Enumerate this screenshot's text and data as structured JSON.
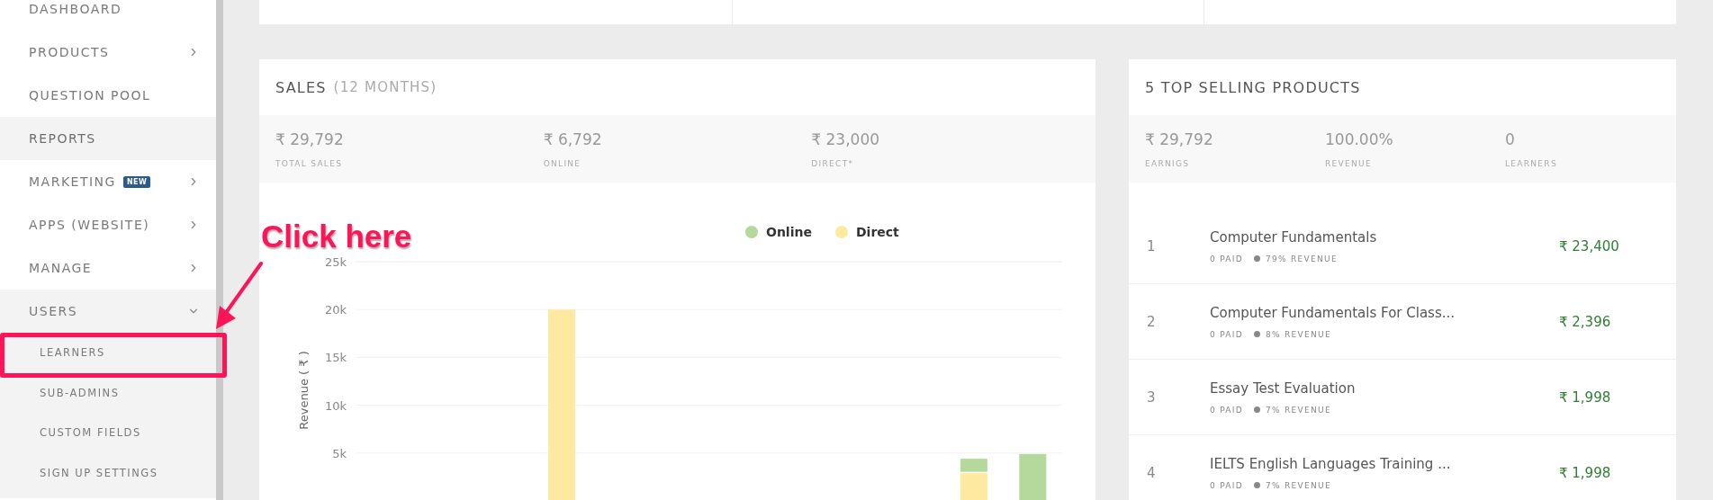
{
  "sidebar": {
    "items": [
      {
        "label": "DASHBOARD",
        "selected": false
      },
      {
        "label": "PRODUCTS",
        "expanded": false,
        "selected": false
      },
      {
        "label": "QUESTION POOL",
        "selected": false
      },
      {
        "label": "REPORTS",
        "selected": true
      },
      {
        "label": "MARKETING",
        "badge": "NEW",
        "expanded": false,
        "selected": false
      },
      {
        "label": "APPS (WEBSITE)",
        "expanded": false,
        "selected": false
      },
      {
        "label": "MANAGE",
        "expanded": false,
        "selected": false
      },
      {
        "label": "USERS",
        "expanded": true,
        "selected": false,
        "children": [
          {
            "label": "LEARNERS",
            "selected": false
          },
          {
            "label": "SUB-ADMINS",
            "selected": false
          },
          {
            "label": "CUSTOM FIELDS",
            "selected": false
          },
          {
            "label": "SIGN UP SETTINGS",
            "selected": false
          }
        ]
      }
    ]
  },
  "annotation": {
    "text": "Click here"
  },
  "sales": {
    "title": "SALES",
    "subtitle": "(12 MONTHS)",
    "stats": [
      {
        "value": "₹ 29,792",
        "label": "TOTAL SALES"
      },
      {
        "value": "₹ 6,792",
        "label": "ONLINE"
      },
      {
        "value": "₹ 23,000",
        "label": "DIRECT*"
      }
    ],
    "chart_data": {
      "type": "bar",
      "stacked": true,
      "grid": true,
      "legend": true,
      "ylabel": "Revenue ( ₹ )",
      "ylim": [
        0,
        25000
      ],
      "yticks": [
        {
          "value": 5000,
          "label": "5k"
        },
        {
          "value": 10000,
          "label": "10k"
        },
        {
          "value": 15000,
          "label": "15k"
        },
        {
          "value": 20000,
          "label": "20k"
        },
        {
          "value": 25000,
          "label": "25k"
        }
      ],
      "series": [
        {
          "name": "Online",
          "color": "#b5d99c",
          "values": [
            null,
            null,
            null,
            null,
            null,
            null,
            null,
            null,
            null,
            null,
            1500,
            4900
          ]
        },
        {
          "name": "Direct",
          "color": "#fde9a0",
          "values": [
            null,
            null,
            null,
            20000,
            null,
            null,
            null,
            null,
            null,
            null,
            2900,
            null
          ]
        }
      ]
    }
  },
  "top_products": {
    "title": "5 TOP SELLING PRODUCTS",
    "stats": [
      {
        "value": "₹ 29,792",
        "label": "EARNIGS"
      },
      {
        "value": "100.00%",
        "label": "REVENUE"
      },
      {
        "value": "0",
        "label": "LEARNERS"
      }
    ],
    "rows": [
      {
        "rank": "1",
        "name": "Computer Fundamentals",
        "paid": "0 PAID",
        "share": "79% REVENUE",
        "amount": "₹ 23,400"
      },
      {
        "rank": "2",
        "name": "Computer Fundamentals For Class...",
        "paid": "0 PAID",
        "share": "8% REVENUE",
        "amount": "₹ 2,396"
      },
      {
        "rank": "3",
        "name": "Essay Test Evaluation",
        "paid": "0 PAID",
        "share": "7% REVENUE",
        "amount": "₹ 1,998"
      },
      {
        "rank": "4",
        "name": "IELTS English Languages Training ...",
        "paid": "0 PAID",
        "share": "7% REVENUE",
        "amount": "₹ 1,998"
      }
    ]
  }
}
